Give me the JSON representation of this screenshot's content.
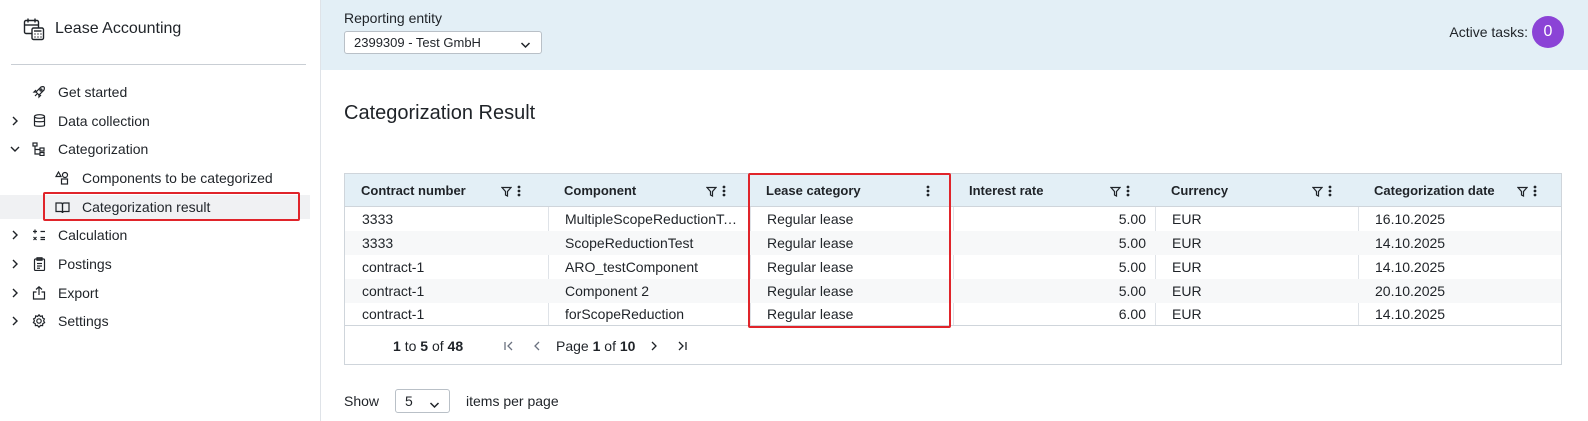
{
  "app": {
    "title": "Lease Accounting"
  },
  "sidebar": {
    "items": [
      {
        "label": "Get started",
        "icon": "rocket-icon"
      },
      {
        "label": "Data collection",
        "icon": "database-icon"
      },
      {
        "label": "Categorization",
        "icon": "hierarchy-icon"
      },
      {
        "label": "Components to be categorized",
        "icon": "shapes-icon"
      },
      {
        "label": "Categorization result",
        "icon": "book-icon"
      },
      {
        "label": "Calculation",
        "icon": "calculator-icon"
      },
      {
        "label": "Postings",
        "icon": "clipboard-icon"
      },
      {
        "label": "Export",
        "icon": "export-icon"
      },
      {
        "label": "Settings",
        "icon": "gear-icon"
      }
    ]
  },
  "header": {
    "entity_label": "Reporting entity",
    "entity_value": "2399309 - Test GmbH",
    "active_tasks_label": "Active tasks:",
    "active_tasks_count": "0"
  },
  "main": {
    "title": "Categorization Result",
    "table": {
      "columns": [
        "Contract number",
        "Component",
        "Lease category",
        "Interest rate",
        "Currency",
        "Categorization date"
      ],
      "rows": [
        [
          "3333",
          "MultipleScopeReductionTest",
          "Regular lease",
          "5.00",
          "EUR",
          "16.10.2025"
        ],
        [
          "3333",
          "ScopeReductionTest",
          "Regular lease",
          "5.00",
          "EUR",
          "14.10.2025"
        ],
        [
          "contract-1",
          "ARO_testComponent",
          "Regular lease",
          "5.00",
          "EUR",
          "14.10.2025"
        ],
        [
          "contract-1",
          "Component 2",
          "Regular lease",
          "5.00",
          "EUR",
          "20.10.2025"
        ],
        [
          "contract-1",
          "forScopeReduction",
          "Regular lease",
          "6.00",
          "EUR",
          "14.10.2025"
        ]
      ]
    },
    "pagination": {
      "from": "1",
      "to_word": "to",
      "to": "5",
      "of_word": "of",
      "total": "48",
      "page_word": "Page",
      "page": "1",
      "pages": "10"
    },
    "page_size": {
      "show_label": "Show",
      "value": "5",
      "suffix": "items per page"
    }
  },
  "colors": {
    "accent": "#8b43d6",
    "header_bg": "#e3eff6",
    "highlight": "#e0242a"
  }
}
